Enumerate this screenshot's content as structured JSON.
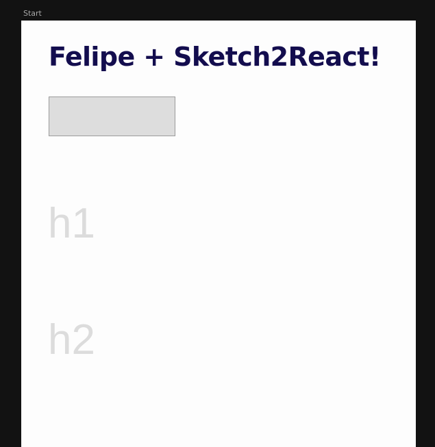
{
  "canvas": {
    "frame_label": "Start"
  },
  "artboard": {
    "title": "Felipe + Sketch2React!",
    "samples": {
      "h1_text": "h1",
      "h2_text": "h2"
    }
  },
  "colors": {
    "title": "#130d4e",
    "placeholder_fill": "#dddddd",
    "sample_text": "#dcdcdc",
    "canvas_background": "#121212",
    "artboard_background": "#fdfdfd"
  }
}
